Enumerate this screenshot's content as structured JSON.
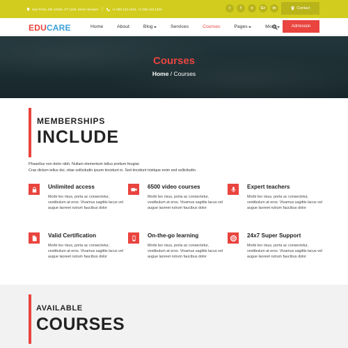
{
  "topbar": {
    "address": "San Porto, DB 12345, VT 1234, Some Semper",
    "phones": "+1 000 123 1234, +1 000 123 1234",
    "socials": [
      {
        "label": "t",
        "icon": "twitter-icon"
      },
      {
        "label": "f",
        "icon": "facebook-icon"
      },
      {
        "label": "v",
        "icon": "vimeo-icon"
      },
      {
        "label": "G+",
        "icon": "google-plus-icon"
      },
      {
        "label": "in",
        "icon": "linkedin-icon"
      }
    ],
    "contact_label": "Contact"
  },
  "nav": {
    "logo_a": "EDU",
    "logo_b": "CARE",
    "items": [
      {
        "label": "Home",
        "dropdown": false
      },
      {
        "label": "About",
        "dropdown": false
      },
      {
        "label": "Blog",
        "dropdown": true
      },
      {
        "label": "Services",
        "dropdown": false
      },
      {
        "label": "Courses",
        "dropdown": false,
        "active": true
      },
      {
        "label": "Pages",
        "dropdown": true
      },
      {
        "label": "More",
        "dropdown": true
      }
    ],
    "admission_label": "Admission"
  },
  "hero": {
    "title": "Courses",
    "crumb_home": "Home",
    "crumb_sep": " / ",
    "crumb_current": "Courses"
  },
  "membership": {
    "small": "MEMBERSHIPS",
    "big": "INCLUDE",
    "intro_line1": "Phasellus non dolor nibh. Nullam elementum tellus pretium feugiat.",
    "intro_line2": "Cras dictum tellus dui, vitae sollicitudin ipsum tincidunt in. Sed tincidunt tristique enim sed sollicitudin."
  },
  "features": [
    {
      "title": "Unlimited access",
      "icon": "lock-icon",
      "desc": "Morbi leo risus, porta ac consectetur, vestibulum at eros. Vivamus sagittis lacus vel augue laoreet rutrum faucibus dolor"
    },
    {
      "title": "6500 video courses",
      "icon": "video-camera-icon",
      "desc": "Morbi leo risus, porta ac consectetur, vestibulum at eros. Vivamus sagittis lacus vel augue laoreet rutrum faucibus dolor"
    },
    {
      "title": "Expert teachers",
      "icon": "microphone-icon",
      "desc": "Morbi leo risus, porta ac consectetur, vestibulum at eros. Vivamus sagittis lacus vel augue laoreet rutrum faucibus dolor"
    },
    {
      "title": "Valid Certification",
      "icon": "document-icon",
      "desc": "Morbi leo risus, porta ac consectetur, vestibulum at eros. Vivamus sagittis lacus vel augue laoreet rutrum faucibus dolor"
    },
    {
      "title": "On-the-go learning",
      "icon": "mobile-phone-icon",
      "desc": "Morbi leo risus, porta ac consectetur, vestibulum at eros. Vivamus sagittis lacus vel augue laoreet rutrum faucibus dolor"
    },
    {
      "title": "24x7 Super Support",
      "icon": "lifebuoy-icon",
      "desc": "Morbi leo risus, porta ac consectetur, vestibulum at eros. Vivamus sagittis lacus vel augue laoreet rutrum faucibus dolor"
    }
  ],
  "available": {
    "small": "AVAILABLE",
    "big": "COURSES"
  },
  "colors": {
    "topbar": "#d2cc1e",
    "accent": "#e9443e",
    "logo_blue": "#3ba0d6",
    "hero_bg": "#1c2e33",
    "section_bg": "#f2f2f2"
  }
}
